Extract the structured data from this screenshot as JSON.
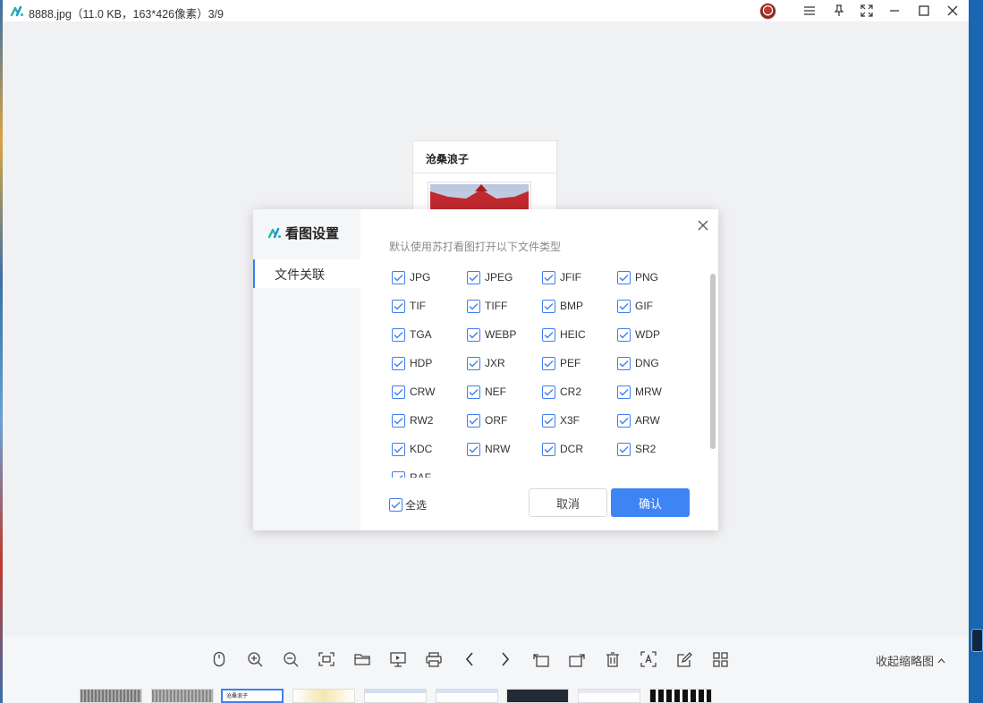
{
  "titlebar": {
    "title": "8888.jpg（11.0 KB，163*426像素）3/9"
  },
  "document": {
    "header": "沧桑浪子"
  },
  "dialog": {
    "brand": "看图设置",
    "nav_item": "文件关联",
    "heading": "默认使用苏打看图打开以下文件类型",
    "formats": [
      "JPG",
      "JPEG",
      "JFIF",
      "PNG",
      "TIF",
      "TIFF",
      "BMP",
      "GIF",
      "TGA",
      "WEBP",
      "HEIC",
      "WDP",
      "HDP",
      "JXR",
      "PEF",
      "DNG",
      "CRW",
      "NEF",
      "CR2",
      "MRW",
      "RW2",
      "ORF",
      "X3F",
      "ARW",
      "KDC",
      "NRW",
      "DCR",
      "SR2",
      "RAF"
    ],
    "select_all": "全选",
    "cancel": "取消",
    "confirm": "确认"
  },
  "toolbar": {
    "collapse_label": "收起缩略图",
    "tools": [
      "mouse-icon",
      "zoom-in-icon",
      "zoom-out-icon",
      "fit-screen-icon",
      "open-folder-icon",
      "slideshow-icon",
      "print-icon",
      "previous-icon",
      "next-icon",
      "rotate-left-icon",
      "rotate-right-icon",
      "delete-icon",
      "ocr-icon",
      "edit-icon",
      "grid-view-icon"
    ]
  },
  "thumbnails": {
    "active_label": "沧桑浪子"
  },
  "colors": {
    "accent": "#3e84f4",
    "background": "#f0f1f3"
  }
}
